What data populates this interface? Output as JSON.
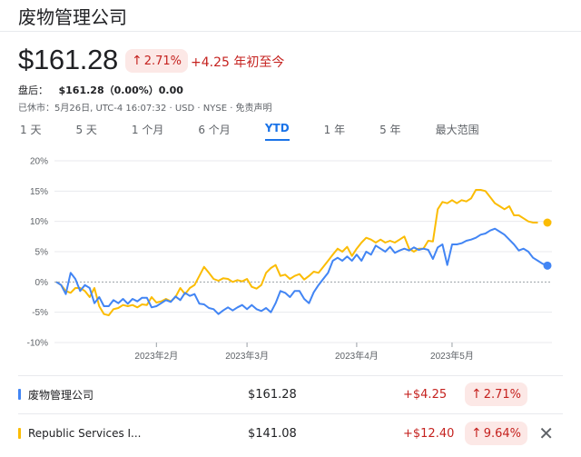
{
  "header": {
    "title": "废物管理公司"
  },
  "quote": {
    "price": "$161.28",
    "change_pct": "2.71%",
    "change_abs": "+4.25",
    "period_label": "年初至今",
    "after_hours_label": "盘后：",
    "after_hours_value": "$161.28（0.00%）0.00",
    "meta": "已休市：5月26日, UTC-4 16:07:32 · USD · NYSE · 免责声明"
  },
  "tabs": [
    {
      "label": "1 天"
    },
    {
      "label": "5 天"
    },
    {
      "label": "1 个月"
    },
    {
      "label": "6 个月"
    },
    {
      "label": "YTD",
      "active": true
    },
    {
      "label": "1 年"
    },
    {
      "label": "5 年"
    },
    {
      "label": "最大范围"
    }
  ],
  "colors": {
    "wm": "#4285f4",
    "rsg": "#fbbc04",
    "negative": "#c5221f",
    "active_tab": "#1a73e8"
  },
  "chart_data": {
    "type": "line",
    "y_ticks": [
      "20%",
      "15%",
      "10%",
      "5%",
      "0%",
      "-5%",
      "-10%"
    ],
    "ylim": [
      -10,
      20
    ],
    "x_ticks": [
      {
        "label": "2023年2月",
        "index": 21
      },
      {
        "label": "2023年3月",
        "index": 40
      },
      {
        "label": "2023年4月",
        "index": 63
      },
      {
        "label": "2023年5月",
        "index": 83
      }
    ],
    "grid": true,
    "series": [
      {
        "name": "废物管理公司",
        "values": [
          0,
          -0.5,
          -2,
          1.5,
          0.5,
          -1.5,
          -0.5,
          -1,
          -3.5,
          -2.5,
          -4,
          -4,
          -3,
          -3.5,
          -2.8,
          -3.6,
          -2.8,
          -3.2,
          -2.6,
          -2.6,
          -4.2,
          -4,
          -3.5,
          -3,
          -3.3,
          -2.4,
          -3,
          -1.8,
          -2.3,
          -2,
          -3.6,
          -3.7,
          -4.3,
          -4.5,
          -5.3,
          -4.7,
          -4.2,
          -4.7,
          -4.2,
          -3.8,
          -4.5,
          -3.8,
          -4.5,
          -4.8,
          -4.3,
          -5,
          -3.5,
          -1.5,
          -1.8,
          -2.5,
          -1.5,
          -1.5,
          -2.8,
          -3.5,
          -1.7,
          -0.5,
          0.5,
          1.5,
          3.5,
          4,
          3.5,
          4.2,
          3.5,
          4.5,
          3.5,
          5,
          4.5,
          6,
          5.5,
          5,
          5.8,
          4.8,
          5.2,
          5.5,
          5.2,
          5.7,
          5.3,
          5.5,
          5.3,
          3.8,
          5.7,
          6.2,
          2.8,
          6.2,
          6.2,
          6.4,
          6.8,
          7,
          7.3,
          7.8,
          8,
          8.5,
          8.8,
          8.3,
          7.8,
          7,
          6.2,
          5.2,
          5.5,
          5,
          4,
          3.5,
          3,
          2.7
        ],
        "last_value_note": "2.71%"
      },
      {
        "name": "Republic Services I...",
        "values": [
          0,
          -0.5,
          -1.5,
          -1.8,
          -1,
          -1,
          -1.5,
          -2.5,
          -1,
          -4,
          -5.3,
          -5.5,
          -4.5,
          -4.3,
          -3.8,
          -4,
          -3.8,
          -4.2,
          -3.7,
          -3.8,
          -2.5,
          -3.4,
          -3.2,
          -2.8,
          -3.2,
          -2.5,
          -1,
          -2,
          -1,
          -0.5,
          1,
          2.5,
          1.5,
          0.5,
          0.2,
          0.6,
          0.5,
          0,
          0.3,
          0.1,
          0.5,
          -0.8,
          -1.1,
          -0.5,
          1.5,
          2.3,
          2.8,
          1,
          1.2,
          0.5,
          1,
          1.3,
          0.4,
          1,
          1.7,
          1.5,
          2.5,
          3.5,
          4.5,
          5.5,
          5,
          5.8,
          4.3,
          5.5,
          6.5,
          7.3,
          7,
          6.5,
          7,
          6.5,
          6.8,
          6.5,
          7,
          7.5,
          5.5,
          5,
          5.5,
          5.5,
          6.8,
          6.7,
          12,
          13.2,
          13,
          13.5,
          13,
          13.5,
          13.3,
          13.8,
          15.2,
          15.2,
          15,
          14,
          13,
          12.5,
          12,
          12.5,
          11,
          11,
          10.5,
          10,
          9.8,
          9.8
        ],
        "last_value_note": "9.64%"
      }
    ]
  },
  "comparison": {
    "rows": [
      {
        "name": "废物管理公司",
        "price": "$161.28",
        "change": "+$4.25",
        "pct": "2.71%"
      },
      {
        "name": "Republic Services I...",
        "price": "$141.08",
        "change": "+$12.40",
        "pct": "9.64%"
      }
    ],
    "close_glyph": "✕"
  }
}
